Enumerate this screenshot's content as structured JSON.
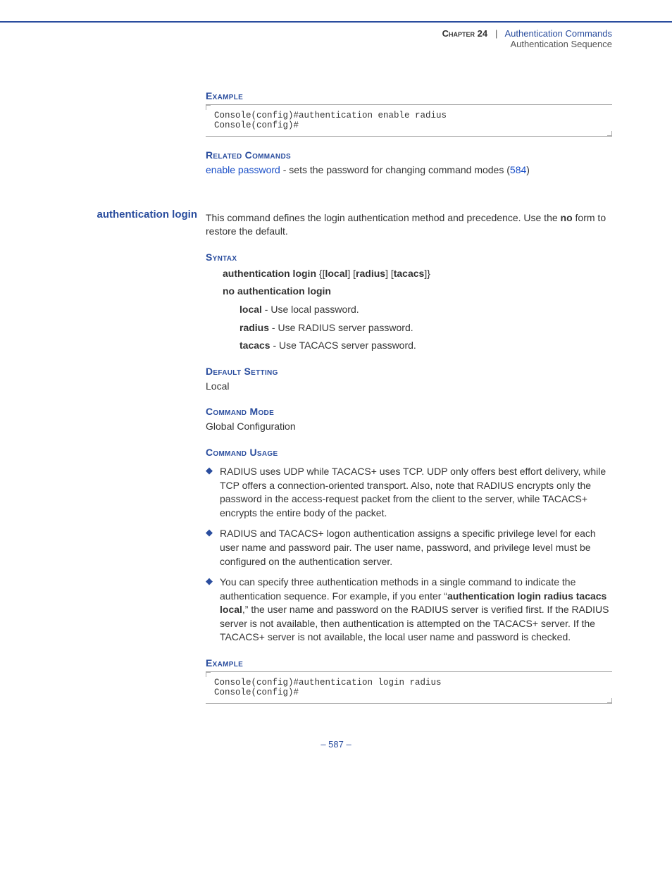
{
  "header": {
    "chapter": "Chapter 24",
    "sep": "|",
    "title": "Authentication Commands",
    "sub": "Authentication Sequence"
  },
  "example1": {
    "heading": "Example",
    "code": "Console(config)#authentication enable radius\nConsole(config)#"
  },
  "related": {
    "heading": "Related Commands",
    "link": "enable password",
    "text": " - sets the password for changing command modes (",
    "pglink": "584",
    "close": ")"
  },
  "command": {
    "name": "authentication login",
    "desc1": "This command defines the login authentication method and precedence. Use the ",
    "desc_bold": "no",
    "desc2": " form to restore the default."
  },
  "syntax": {
    "heading": "Syntax",
    "line1_a": "authentication login",
    "line1_b": " {[",
    "line1_c": "local",
    "line1_d": "] [",
    "line1_e": "radius",
    "line1_f": "] [",
    "line1_g": "tacacs",
    "line1_h": "]}",
    "line2": "no authentication login",
    "opt_local_b": "local",
    "opt_local_t": " - Use local password.",
    "opt_radius_b": "radius",
    "opt_radius_t": " - Use RADIUS server password.",
    "opt_tacacs_b": "tacacs",
    "opt_tacacs_t": " - Use TACACS server password."
  },
  "defset": {
    "heading": "Default Setting",
    "text": "Local"
  },
  "cmdmode": {
    "heading": "Command Mode",
    "text": "Global Configuration"
  },
  "usage": {
    "heading": "Command Usage",
    "b1": "RADIUS uses UDP while TACACS+ uses TCP. UDP only offers best effort delivery, while TCP offers a connection-oriented transport. Also, note that RADIUS encrypts only the password in the access-request packet from the client to the server, while TACACS+ encrypts the entire body of the packet.",
    "b2": "RADIUS and TACACS+ logon authentication assigns a specific privilege level for each user name and password pair. The user name, password, and privilege level must be configured on the authentication server.",
    "b3_a": "You can specify three authentication methods in a single command to indicate the authentication sequence. For example, if you enter “",
    "b3_bold": "authentication login radius tacacs local",
    "b3_b": ",” the user name and password on the RADIUS server is verified first. If the RADIUS server is not available, then authentication is attempted on the TACACS+ server. If the TACACS+ server is not available, the local user name and password is checked."
  },
  "example2": {
    "heading": "Example",
    "code": "Console(config)#authentication login radius\nConsole(config)#"
  },
  "footer": "–  587  –"
}
